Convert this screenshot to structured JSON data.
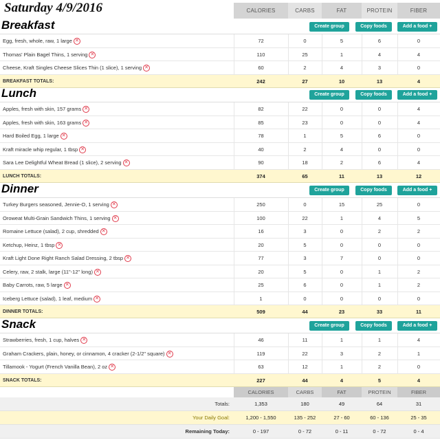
{
  "date": "Saturday 4/9/2016",
  "columns": [
    "CALORIES",
    "CARBS",
    "FAT",
    "PROTEIN",
    "FIBER"
  ],
  "buttons": {
    "create_group": "Create group",
    "copy_foods": "Copy foods",
    "add_food": "Add a food +"
  },
  "meals": [
    {
      "title": "Breakfast",
      "items": [
        {
          "name": "Egg, fresh, whole, raw, 1 large",
          "cal": "72",
          "carbs": "0",
          "fat": "5",
          "protein": "6",
          "fiber": "0"
        },
        {
          "name": "Thomas' Plain Bagel Thins, 1 serving",
          "cal": "110",
          "carbs": "25",
          "fat": "1",
          "protein": "4",
          "fiber": "4"
        },
        {
          "name": "Cheese, Kraft Singles Cheese Slices Thin (1 slice), 1 serving",
          "cal": "60",
          "carbs": "2",
          "fat": "4",
          "protein": "3",
          "fiber": "0"
        }
      ],
      "totals": {
        "label": "BREAKFAST TOTALS:",
        "cal": "242",
        "carbs": "27",
        "fat": "10",
        "protein": "13",
        "fiber": "4"
      }
    },
    {
      "title": "Lunch",
      "items": [
        {
          "name": "Apples, fresh with skin, 157 grams",
          "cal": "82",
          "carbs": "22",
          "fat": "0",
          "protein": "0",
          "fiber": "4"
        },
        {
          "name": "Apples, fresh with skin, 163 grams",
          "cal": "85",
          "carbs": "23",
          "fat": "0",
          "protein": "0",
          "fiber": "4"
        },
        {
          "name": "Hard Boiled Egg, 1 large",
          "cal": "78",
          "carbs": "1",
          "fat": "5",
          "protein": "6",
          "fiber": "0"
        },
        {
          "name": "Kraft miracle whip regular, 1 tbsp",
          "cal": "40",
          "carbs": "2",
          "fat": "4",
          "protein": "0",
          "fiber": "0"
        },
        {
          "name": "Sara Lee Delightful Wheat Bread (1 slice), 2 serving",
          "cal": "90",
          "carbs": "18",
          "fat": "2",
          "protein": "6",
          "fiber": "4"
        }
      ],
      "totals": {
        "label": "LUNCH TOTALS:",
        "cal": "374",
        "carbs": "65",
        "fat": "11",
        "protein": "13",
        "fiber": "12"
      }
    },
    {
      "title": "Dinner",
      "items": [
        {
          "name": "Turkey Burgers seasoned, Jennie-O, 1 serving",
          "cal": "250",
          "carbs": "0",
          "fat": "15",
          "protein": "25",
          "fiber": "0"
        },
        {
          "name": "Oroweat Multi-Grain Sandwich Thins, 1 serving",
          "cal": "100",
          "carbs": "22",
          "fat": "1",
          "protein": "4",
          "fiber": "5"
        },
        {
          "name": "Romaine Lettuce (salad), 2 cup, shredded",
          "cal": "16",
          "carbs": "3",
          "fat": "0",
          "protein": "2",
          "fiber": "2"
        },
        {
          "name": "Ketchup, Heinz, 1 tbsp",
          "cal": "20",
          "carbs": "5",
          "fat": "0",
          "protein": "0",
          "fiber": "0"
        },
        {
          "name": "Kraft Light Done Right Ranch Salad Dressing, 2 tbsp",
          "cal": "77",
          "carbs": "3",
          "fat": "7",
          "protein": "0",
          "fiber": "0"
        },
        {
          "name": "Celery, raw, 2 stalk, large (11\"-12\" long)",
          "cal": "20",
          "carbs": "5",
          "fat": "0",
          "protein": "1",
          "fiber": "2"
        },
        {
          "name": "Baby Carrots, raw, 5 large",
          "cal": "25",
          "carbs": "6",
          "fat": "0",
          "protein": "1",
          "fiber": "2"
        },
        {
          "name": "Iceberg Lettuce (salad), 1 leaf, medium",
          "cal": "1",
          "carbs": "0",
          "fat": "0",
          "protein": "0",
          "fiber": "0"
        }
      ],
      "totals": {
        "label": "DINNER TOTALS:",
        "cal": "509",
        "carbs": "44",
        "fat": "23",
        "protein": "33",
        "fiber": "11"
      }
    },
    {
      "title": "Snack",
      "items": [
        {
          "name": "Strawberries, fresh, 1 cup, halves",
          "cal": "46",
          "carbs": "11",
          "fat": "1",
          "protein": "1",
          "fiber": "4"
        },
        {
          "name": "Graham Crackers, plain, honey, or cinnamon, 4 cracker (2-1/2\" square)",
          "cal": "119",
          "carbs": "22",
          "fat": "3",
          "protein": "2",
          "fiber": "1"
        },
        {
          "name": "Tillamook - Yogurt (French Vanilla Bean), 2 oz",
          "cal": "63",
          "carbs": "12",
          "fat": "1",
          "protein": "2",
          "fiber": "0"
        }
      ],
      "totals": {
        "label": "SNACK TOTALS:",
        "cal": "227",
        "carbs": "44",
        "fat": "4",
        "protein": "5",
        "fiber": "4"
      }
    }
  ],
  "summary": {
    "totals": {
      "label": "Totals:",
      "cal": "1,353",
      "carbs": "180",
      "fat": "49",
      "protein": "64",
      "fiber": "31"
    },
    "goal": {
      "label": "Your Daily Goal:",
      "cal": "1,200 - 1,550",
      "carbs": "135 - 252",
      "fat": "27 - 60",
      "protein": "60 - 136",
      "fiber": "25 - 35"
    },
    "remaining": {
      "label": "Remaining Today:",
      "cal": "0 - 197",
      "carbs": "0 - 72",
      "fat": "0 - 11",
      "protein": "0 - 72",
      "fiber": "0 - 4"
    }
  }
}
